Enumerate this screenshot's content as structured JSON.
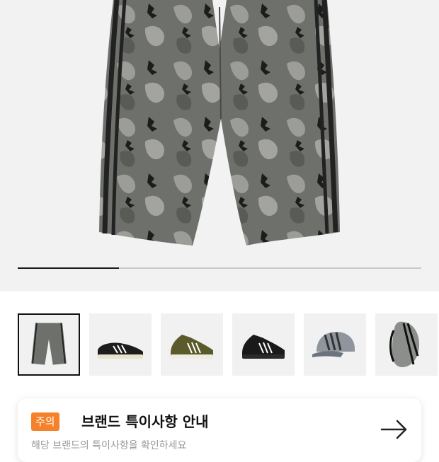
{
  "product": {
    "main_image": "camo-cargo-pants",
    "image_progress": 0.25
  },
  "thumbnails": [
    {
      "item": "camo-pants",
      "selected": true
    },
    {
      "item": "black-superstar-sneaker",
      "selected": false
    },
    {
      "item": "camo-high-top-sneaker",
      "selected": false
    },
    {
      "item": "black-high-top-sneaker",
      "selected": false
    },
    {
      "item": "camo-cap",
      "selected": false
    },
    {
      "item": "camo-sling-bag",
      "selected": false
    }
  ],
  "notice": {
    "badge": "주의",
    "title": "브랜드 특이사항 안내",
    "subtitle": "해당 브랜드의 특이사항을 확인하세요",
    "arrow_icon": "arrow-right-icon",
    "badge_color": "#f5822a"
  }
}
